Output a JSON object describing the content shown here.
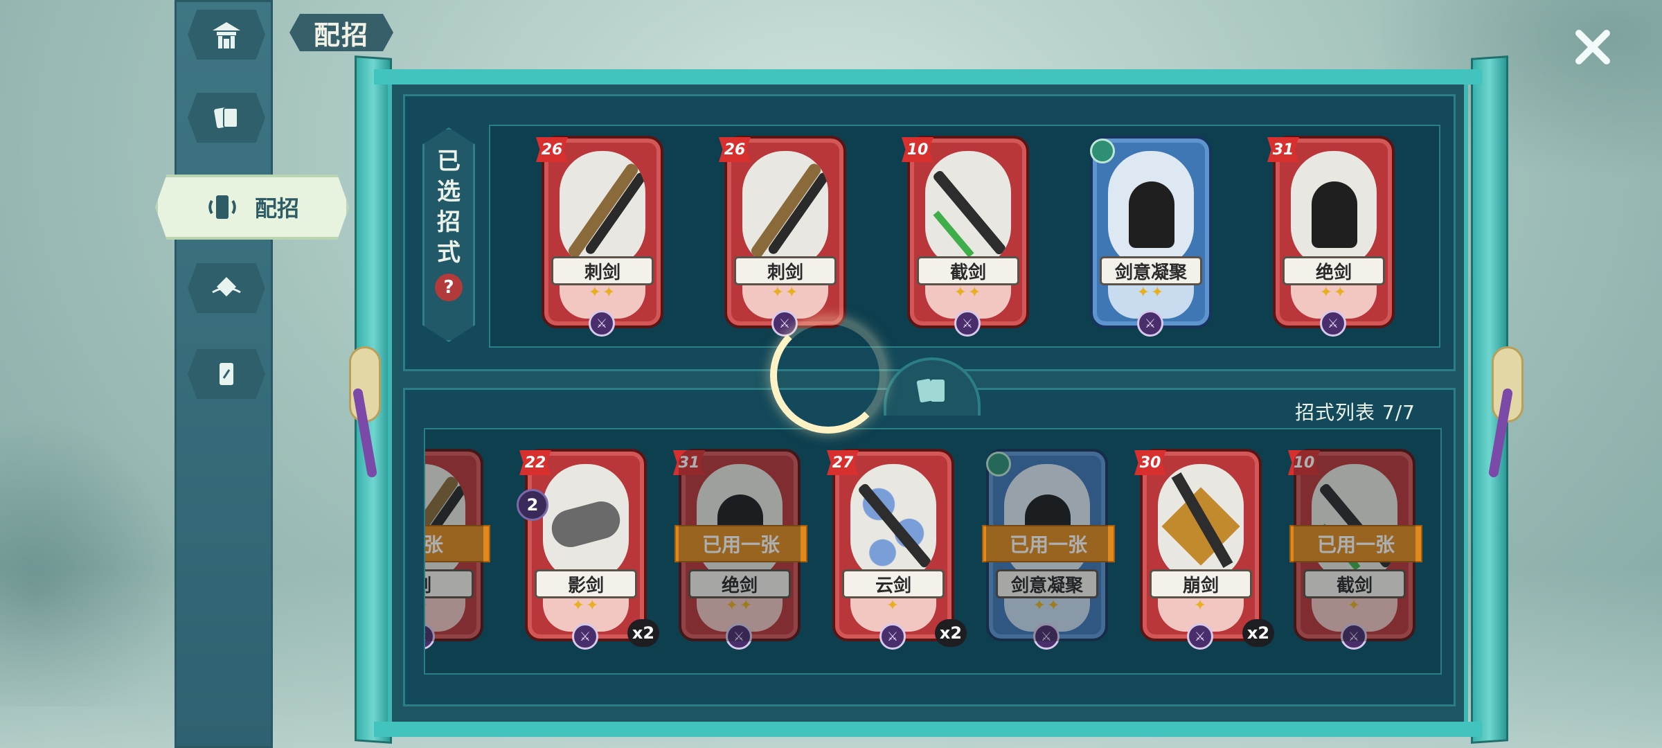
{
  "header": {
    "title": "配招"
  },
  "sidebar": {
    "items": [
      {
        "icon": "pavilion-icon",
        "label": ""
      },
      {
        "icon": "cards-icon",
        "label": ""
      },
      {
        "icon": "card-loadout-icon",
        "label": "配招",
        "active": true
      },
      {
        "icon": "emblem-icon",
        "label": ""
      },
      {
        "icon": "single-card-icon",
        "label": ""
      }
    ]
  },
  "selected_section": {
    "label_chars": [
      "已",
      "选",
      "招",
      "式"
    ],
    "help_glyph": "?",
    "cards": [
      {
        "name": "刺剑",
        "cost": "26",
        "stars": "✦✦",
        "color": "red",
        "art": "slash"
      },
      {
        "name": "刺剑",
        "cost": "26",
        "stars": "✦✦",
        "color": "red",
        "art": "slash"
      },
      {
        "name": "截剑",
        "cost": "10",
        "stars": "✦✦",
        "color": "red",
        "art": "blade"
      },
      {
        "name": "剑意凝聚",
        "cost": "",
        "stars": "✦✦",
        "color": "blue",
        "art": "figure"
      },
      {
        "name": "绝剑",
        "cost": "31",
        "stars": "✦✦",
        "color": "red",
        "art": "figure"
      }
    ]
  },
  "list_section": {
    "title": "招式列表 7/7",
    "cards": [
      {
        "name": "剑",
        "cost": "",
        "stars": "✦",
        "color": "red",
        "art": "slash",
        "overlay": "两张",
        "dim": true,
        "partial": true
      },
      {
        "name": "影剑",
        "cost": "22",
        "stars": "✦✦",
        "color": "red",
        "art": "claw",
        "count": "2",
        "multiplier": "x2"
      },
      {
        "name": "绝剑",
        "cost": "31",
        "stars": "✦✦",
        "color": "red",
        "art": "figure",
        "overlay": "已用一张",
        "dim": true
      },
      {
        "name": "云剑",
        "cost": "27",
        "stars": "✦",
        "color": "red",
        "art": "cloud",
        "multiplier": "x2"
      },
      {
        "name": "剑意凝聚",
        "cost": "",
        "stars": "✦✦",
        "color": "blue",
        "art": "figure",
        "overlay": "已用一张",
        "dim": true
      },
      {
        "name": "崩剑",
        "cost": "30",
        "stars": "✦",
        "color": "red",
        "art": "burst",
        "multiplier": "x2"
      },
      {
        "name": "截剑",
        "cost": "10",
        "stars": "✦",
        "color": "red",
        "art": "blade",
        "overlay": "已用一张",
        "dim": true
      }
    ]
  }
}
